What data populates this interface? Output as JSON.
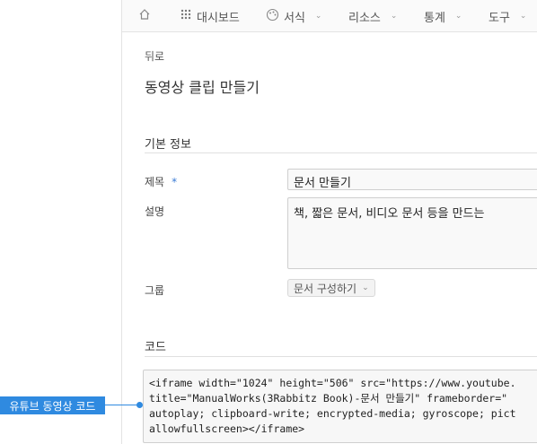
{
  "nav": {
    "home_icon": "home-icon",
    "dashboard": "대시보드",
    "format": "서식",
    "resources": "리소스",
    "stats": "통계",
    "tools": "도구"
  },
  "back": "뒤로",
  "page_title": "동영상 클립 만들기",
  "basic_info": {
    "section_title": "기본 정보",
    "title_label": "제목",
    "required_mark": "*",
    "title_value": "문서 만들기",
    "desc_label": "설명",
    "desc_value": "책, 짧은 문서, 비디오 문서 등을 만드는",
    "group_label": "그룹",
    "group_value": "문서 구성하기"
  },
  "code": {
    "section_title": "코드",
    "lines": [
      "<iframe width=\"1024\" height=\"506\" src=\"https://www.youtube.",
      "title=\"ManualWorks(3Rabbitz Book)-문서 만들기\" frameborder=\"",
      "autoplay; clipboard-write; encrypted-media; gyroscope; pict",
      "allowfullscreen></iframe>"
    ]
  },
  "callout": {
    "label": "유튜브 동영상 코드"
  },
  "colors": {
    "accent": "#2f8ae0",
    "required": "#3a7bd5"
  }
}
